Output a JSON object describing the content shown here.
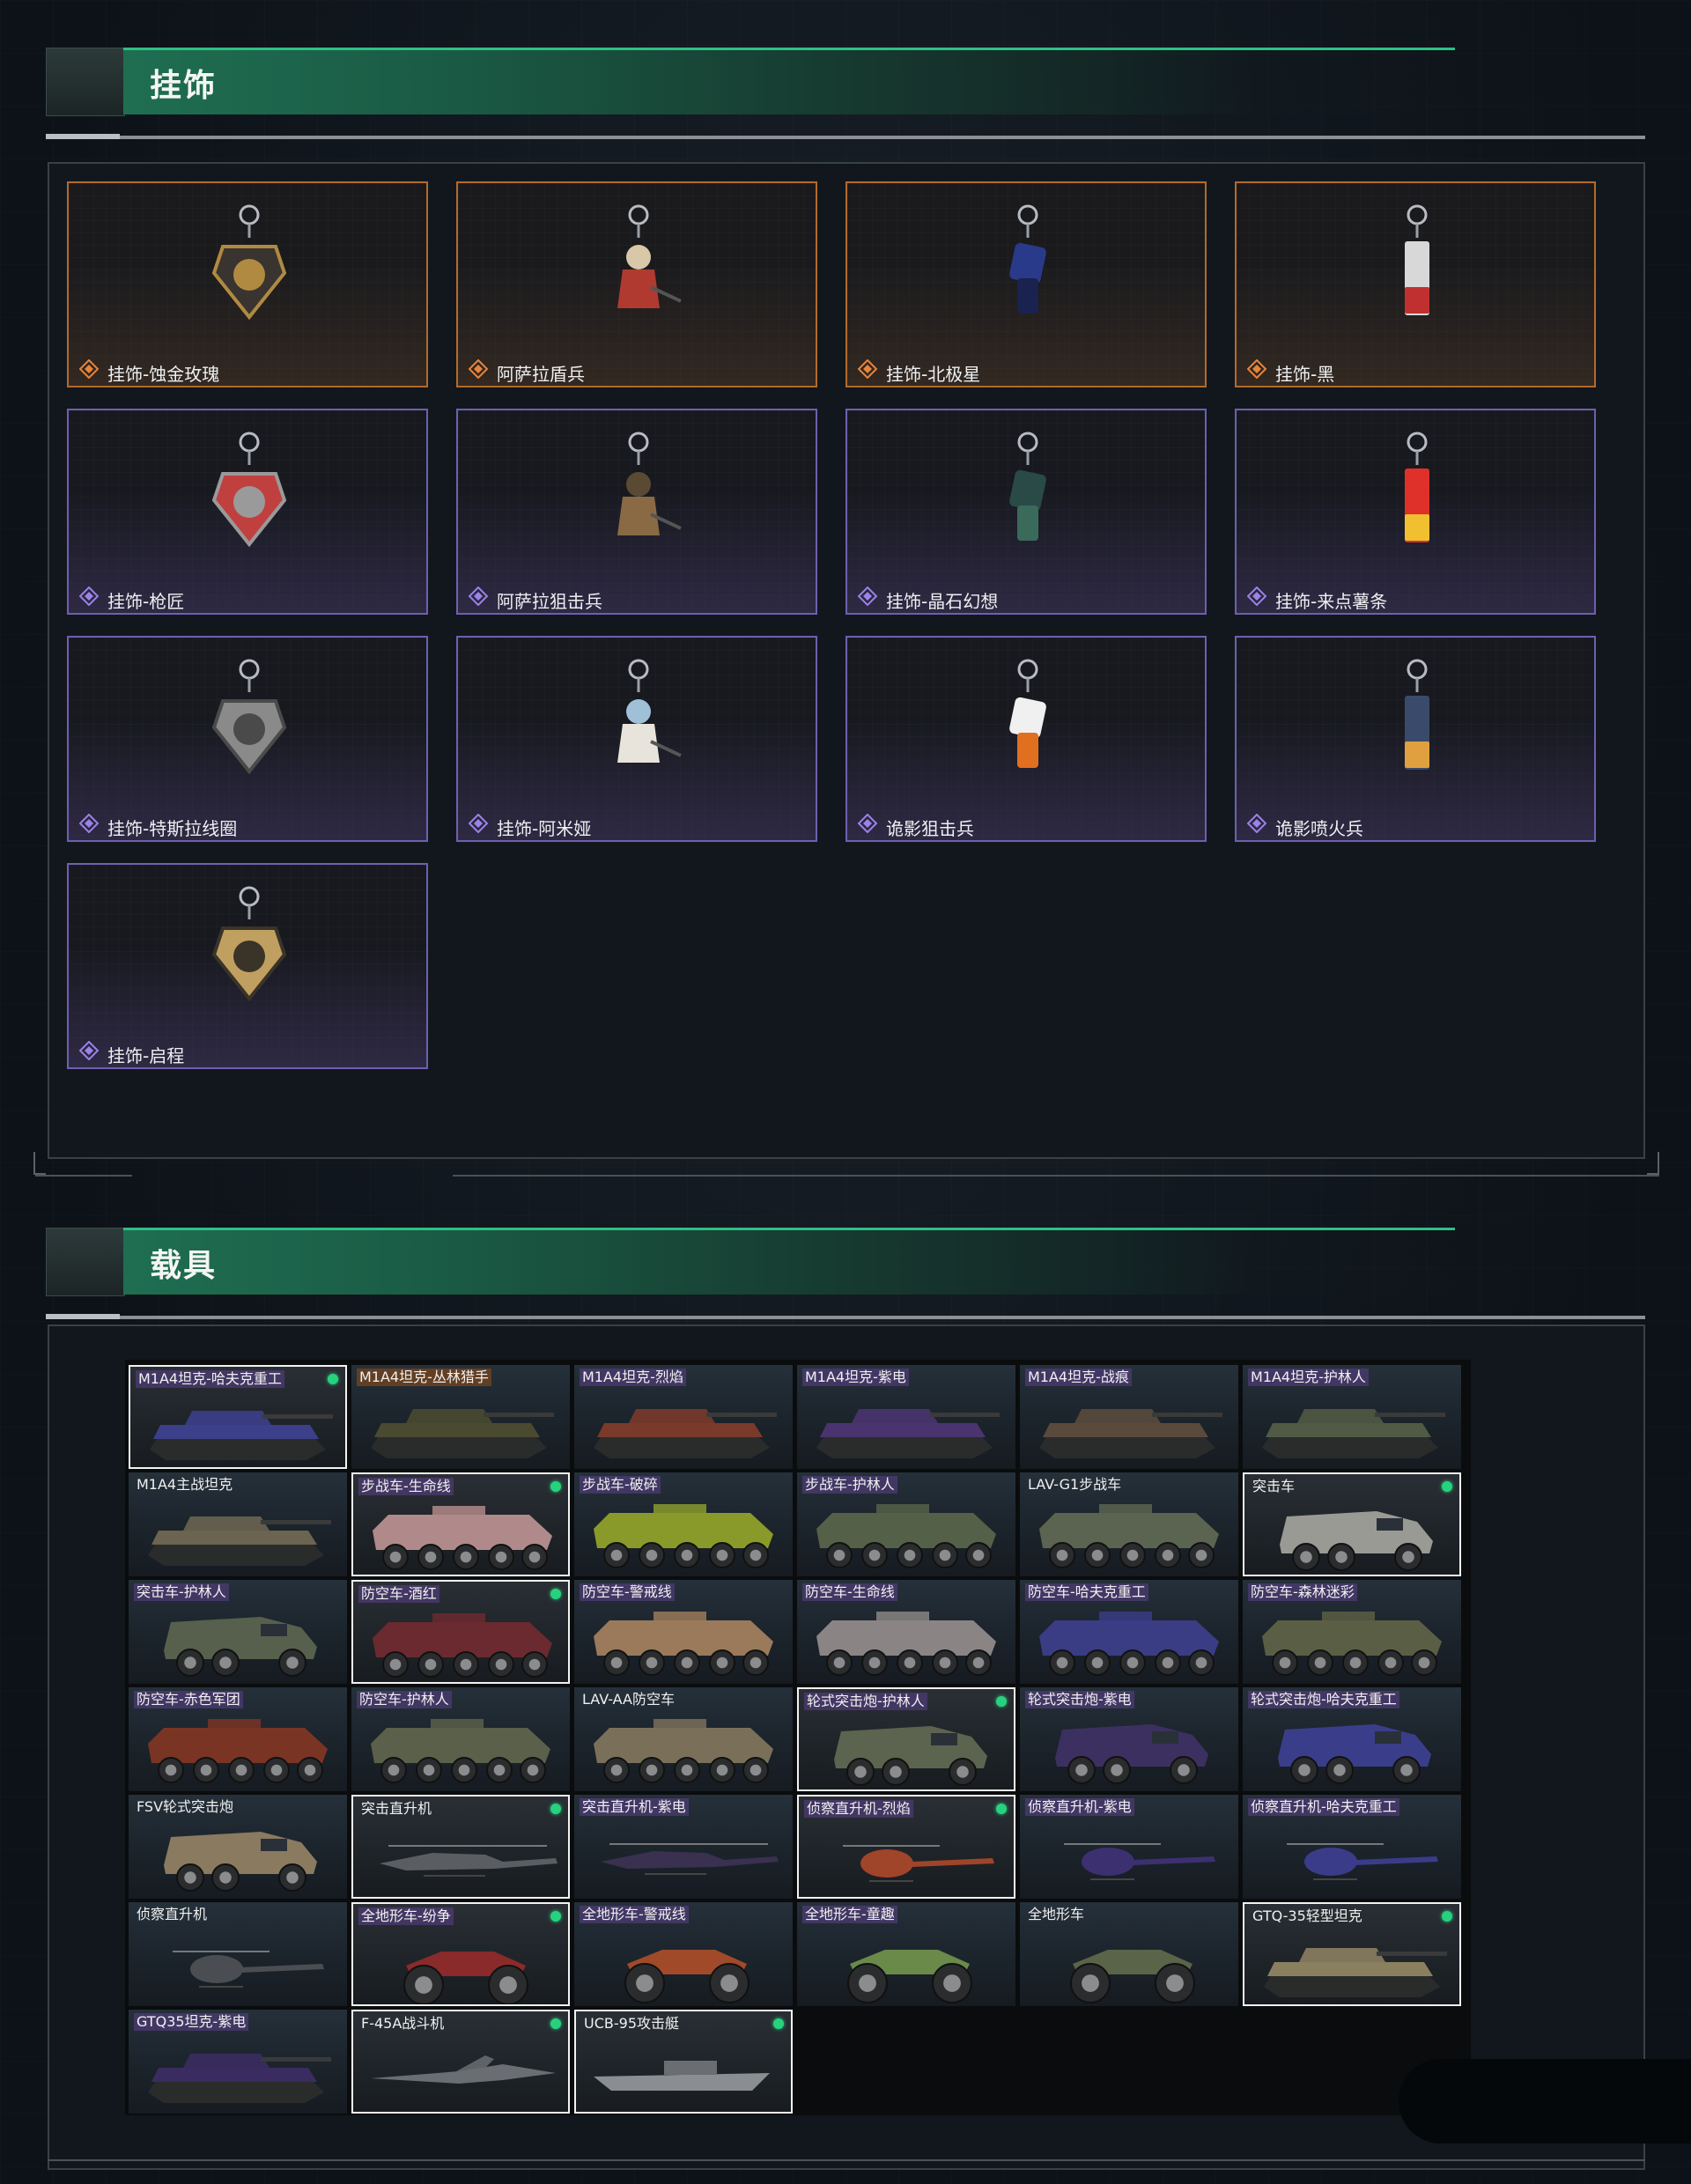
{
  "charms_section": {
    "title": "挂饰",
    "items": [
      {
        "name": "挂饰-蚀金玫瑰",
        "rarity": "orange",
        "icon": "gold-rose-charm-icon"
      },
      {
        "name": "阿萨拉盾兵",
        "rarity": "orange",
        "icon": "shield-soldier-charm-icon"
      },
      {
        "name": "挂饰-北极星",
        "rarity": "orange",
        "icon": "north-star-charm-icon"
      },
      {
        "name": "挂饰-黑",
        "rarity": "orange",
        "icon": "black-tag-charm-icon"
      },
      {
        "name": "挂饰-枪匠",
        "rarity": "purple",
        "icon": "gunsmith-case-charm-icon"
      },
      {
        "name": "阿萨拉狙击兵",
        "rarity": "purple",
        "icon": "sniper-soldier-charm-icon"
      },
      {
        "name": "挂饰-晶石幻想",
        "rarity": "purple",
        "icon": "crystal-cube-charm-icon"
      },
      {
        "name": "挂饰-来点薯条",
        "rarity": "purple",
        "icon": "fries-charm-icon"
      },
      {
        "name": "挂饰-特斯拉线圈",
        "rarity": "purple",
        "icon": "tesla-coil-charm-icon"
      },
      {
        "name": "挂饰-阿米娅",
        "rarity": "purple",
        "icon": "bunny-charm-icon"
      },
      {
        "name": "诡影狙击兵",
        "rarity": "purple",
        "icon": "ghost-sniper-charm-icon"
      },
      {
        "name": "诡影喷火兵",
        "rarity": "purple",
        "icon": "ghost-flamer-charm-icon"
      },
      {
        "name": "挂饰-启程",
        "rarity": "purple",
        "icon": "departure-medal-charm-icon"
      }
    ]
  },
  "vehicles_section": {
    "title": "载具",
    "items": [
      {
        "name": "M1A4坦克-哈夫克重工",
        "kind": "tank",
        "selected": true,
        "owned": true,
        "tag": "purple",
        "color": "#3c3f8a"
      },
      {
        "name": "M1A4坦克-丛林猎手",
        "kind": "tank",
        "selected": false,
        "owned": false,
        "tag": "orange",
        "color": "#4a4a30"
      },
      {
        "name": "M1A4坦克-烈焰",
        "kind": "tank",
        "selected": false,
        "owned": false,
        "tag": "purple",
        "color": "#7a3a2a"
      },
      {
        "name": "M1A4坦克-紫电",
        "kind": "tank",
        "selected": false,
        "owned": false,
        "tag": "purple",
        "color": "#4a3470"
      },
      {
        "name": "M1A4坦克-战痕",
        "kind": "tank",
        "selected": false,
        "owned": false,
        "tag": "purple",
        "color": "#5a4a3c"
      },
      {
        "name": "M1A4坦克-护林人",
        "kind": "tank",
        "selected": false,
        "owned": false,
        "tag": "purple",
        "color": "#505a44"
      },
      {
        "name": "M1A4主战坦克",
        "kind": "tank",
        "selected": false,
        "owned": false,
        "tag": "plain",
        "color": "#6a6450"
      },
      {
        "name": "步战车-生命线",
        "kind": "ifv",
        "selected": true,
        "owned": true,
        "tag": "purple",
        "color": "#b08a8a"
      },
      {
        "name": "步战车-破碎",
        "kind": "ifv",
        "selected": false,
        "owned": false,
        "tag": "purple",
        "color": "#8a9a2a"
      },
      {
        "name": "步战车-护林人",
        "kind": "ifv",
        "selected": false,
        "owned": false,
        "tag": "purple",
        "color": "#556048"
      },
      {
        "name": "LAV-G1步战车",
        "kind": "ifv",
        "selected": false,
        "owned": false,
        "tag": "plain",
        "color": "#5a6450"
      },
      {
        "name": "突击车",
        "kind": "truck",
        "selected": true,
        "owned": true,
        "tag": "plain",
        "color": "#9a9a94"
      },
      {
        "name": "突击车-护林人",
        "kind": "truck",
        "selected": false,
        "owned": false,
        "tag": "purple",
        "color": "#56604c"
      },
      {
        "name": "防空车-酒红",
        "kind": "ifv",
        "selected": true,
        "owned": true,
        "tag": "purple",
        "color": "#6a2a30"
      },
      {
        "name": "防空车-警戒线",
        "kind": "ifv",
        "selected": false,
        "owned": false,
        "tag": "purple",
        "color": "#9a7a5a"
      },
      {
        "name": "防空车-生命线",
        "kind": "ifv",
        "selected": false,
        "owned": false,
        "tag": "purple",
        "color": "#8a8484"
      },
      {
        "name": "防空车-哈夫克重工",
        "kind": "ifv",
        "selected": false,
        "owned": false,
        "tag": "purple",
        "color": "#3a3c84"
      },
      {
        "name": "防空车-森林迷彩",
        "kind": "ifv",
        "selected": false,
        "owned": false,
        "tag": "purple",
        "color": "#5a5e44"
      },
      {
        "name": "防空车-赤色军团",
        "kind": "ifv",
        "selected": false,
        "owned": false,
        "tag": "purple",
        "color": "#7a3424"
      },
      {
        "name": "防空车-护林人",
        "kind": "ifv",
        "selected": false,
        "owned": false,
        "tag": "purple",
        "color": "#5a604a"
      },
      {
        "name": "LAV-AA防空车",
        "kind": "ifv",
        "selected": false,
        "owned": false,
        "tag": "plain",
        "color": "#7a705a"
      },
      {
        "name": "轮式突击炮-护林人",
        "kind": "truck",
        "selected": true,
        "owned": true,
        "tag": "purple",
        "color": "#5c6450"
      },
      {
        "name": "轮式突击炮-紫电",
        "kind": "truck",
        "selected": false,
        "owned": false,
        "tag": "purple",
        "color": "#3c3060"
      },
      {
        "name": "轮式突击炮-哈夫克重工",
        "kind": "truck",
        "selected": false,
        "owned": false,
        "tag": "purple",
        "color": "#3a3e8a"
      },
      {
        "name": "FSV轮式突击炮",
        "kind": "truck",
        "selected": false,
        "owned": false,
        "tag": "plain",
        "color": "#8a7a60"
      },
      {
        "name": "突击直升机",
        "kind": "heli",
        "selected": true,
        "owned": true,
        "tag": "plain",
        "color": "#5a5e62"
      },
      {
        "name": "突击直升机-紫电",
        "kind": "heli",
        "selected": false,
        "owned": false,
        "tag": "purple",
        "color": "#3a3050"
      },
      {
        "name": "侦察直升机-烈焰",
        "kind": "heli-small",
        "selected": true,
        "owned": true,
        "tag": "purple",
        "color": "#a0442a"
      },
      {
        "name": "侦察直升机-紫电",
        "kind": "heli-small",
        "selected": false,
        "owned": false,
        "tag": "purple",
        "color": "#3c3070"
      },
      {
        "name": "侦察直升机-哈夫克重工",
        "kind": "heli-small",
        "selected": false,
        "owned": false,
        "tag": "purple",
        "color": "#3a3c8a"
      },
      {
        "name": "侦察直升机",
        "kind": "heli-small",
        "selected": false,
        "owned": false,
        "tag": "plain",
        "color": "#4a4e52"
      },
      {
        "name": "全地形车-纷争",
        "kind": "atv",
        "selected": true,
        "owned": true,
        "tag": "purple",
        "color": "#8a2a2a"
      },
      {
        "name": "全地形车-警戒线",
        "kind": "atv",
        "selected": false,
        "owned": false,
        "tag": "purple",
        "color": "#a04a2a"
      },
      {
        "name": "全地形车-童趣",
        "kind": "atv",
        "selected": false,
        "owned": false,
        "tag": "purple",
        "color": "#6a8a4a"
      },
      {
        "name": "全地形车",
        "kind": "atv",
        "selected": false,
        "owned": false,
        "tag": "plain",
        "color": "#5a6448"
      },
      {
        "name": "GTQ-35轻型坦克",
        "kind": "tank",
        "selected": true,
        "owned": true,
        "tag": "plain",
        "color": "#8a8060"
      },
      {
        "name": "GTQ35坦克-紫电",
        "kind": "tank",
        "selected": false,
        "owned": false,
        "tag": "purple",
        "color": "#3a2c60"
      },
      {
        "name": "F-45A战斗机",
        "kind": "jet",
        "selected": true,
        "owned": true,
        "tag": "plain",
        "color": "#6a6e72"
      },
      {
        "name": "UCB-95攻击艇",
        "kind": "boat",
        "selected": true,
        "owned": true,
        "tag": "plain",
        "color": "#8a8e92"
      }
    ]
  },
  "colors": {
    "accent_green": "#2fbf86",
    "rarity_orange": "#b36a2c",
    "rarity_purple": "#6e5fb0",
    "owned_dot": "#26d27e"
  }
}
